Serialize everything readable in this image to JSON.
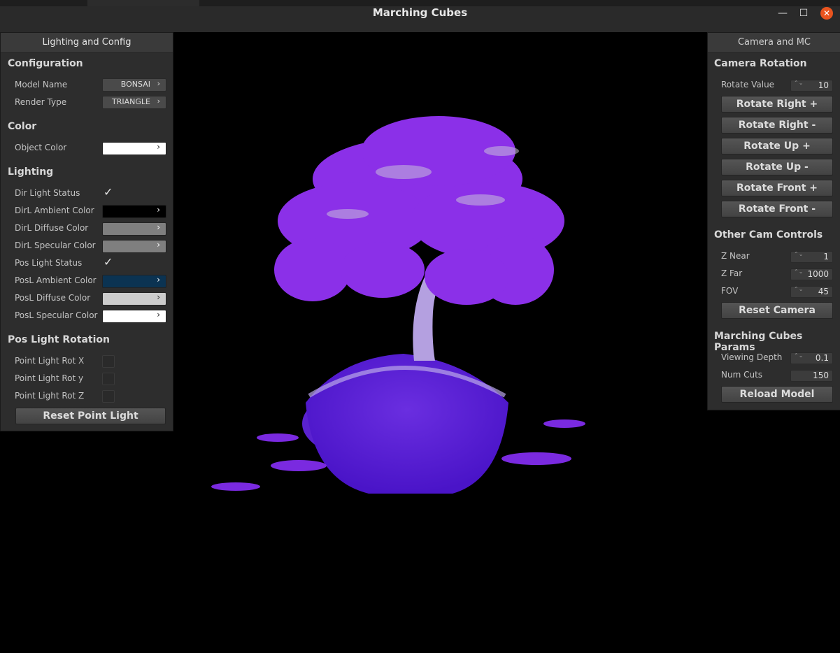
{
  "window": {
    "title": "Marching Cubes",
    "min": "—",
    "max": "☐",
    "close": "✕"
  },
  "left_panel": {
    "header": "Lighting and Config",
    "configuration": {
      "title": "Configuration",
      "model_name_label": "Model Name",
      "model_name_value": "BONSAI",
      "render_type_label": "Render Type",
      "render_type_value": "TRIANGLE"
    },
    "color": {
      "title": "Color",
      "object_color_label": "Object Color",
      "object_color": "#ffffff"
    },
    "lighting": {
      "title": "Lighting",
      "dir_light_status_label": "Dir Light Status",
      "dir_light_status": true,
      "dirl_ambient_label": "DirL Ambient Color",
      "dirl_ambient": "#000000",
      "dirl_diffuse_label": "DirL Diffuse Color",
      "dirl_diffuse": "#7f7f7f",
      "dirl_specular_label": "DirL Specular Color",
      "dirl_specular": "#7f7f7f",
      "pos_light_status_label": "Pos Light Status",
      "pos_light_status": true,
      "posl_ambient_label": "PosL Ambient Color",
      "posl_ambient": "#0b3352",
      "posl_diffuse_label": "PosL Diffuse Color",
      "posl_diffuse": "#cccccc",
      "posl_specular_label": "PosL Specular Color",
      "posl_specular": "#ffffff"
    },
    "pos_light_rotation": {
      "title": "Pos Light Rotation",
      "rot_x_label": "Point Light Rot X",
      "rot_y_label": "Point Light Rot y",
      "rot_z_label": "Point Light Rot Z",
      "reset_button": "Reset Point Light"
    },
    "chevron": "›",
    "check": "✓"
  },
  "right_panel": {
    "header": "Camera and MC",
    "camera_rotation": {
      "title": "Camera Rotation",
      "rotate_value_label": "Rotate Value",
      "rotate_value": "10",
      "buttons": [
        "Rotate Right +",
        "Rotate Right -",
        "Rotate Up +",
        "Rotate Up -",
        "Rotate Front +",
        "Rotate Front -"
      ]
    },
    "other_cam": {
      "title": "Other Cam Controls",
      "znear_label": "Z Near",
      "znear": "1",
      "zfar_label": "Z Far",
      "zfar": "1000",
      "fov_label": "FOV",
      "fov": "45",
      "reset_button": "Reset Camera"
    },
    "mc_params": {
      "title": "Marching Cubes Params",
      "viewing_depth_label": "Viewing Depth",
      "viewing_depth": "0.1",
      "num_cuts_label": "Num Cuts",
      "num_cuts": "150",
      "reload_button": "Reload Model"
    },
    "spin_arrows": "⌃⌄"
  },
  "viewport": {
    "model_colors": {
      "foliage": "#8a2be2",
      "pot": "#5a1fd8",
      "highlight": "#c0c0c0"
    }
  }
}
